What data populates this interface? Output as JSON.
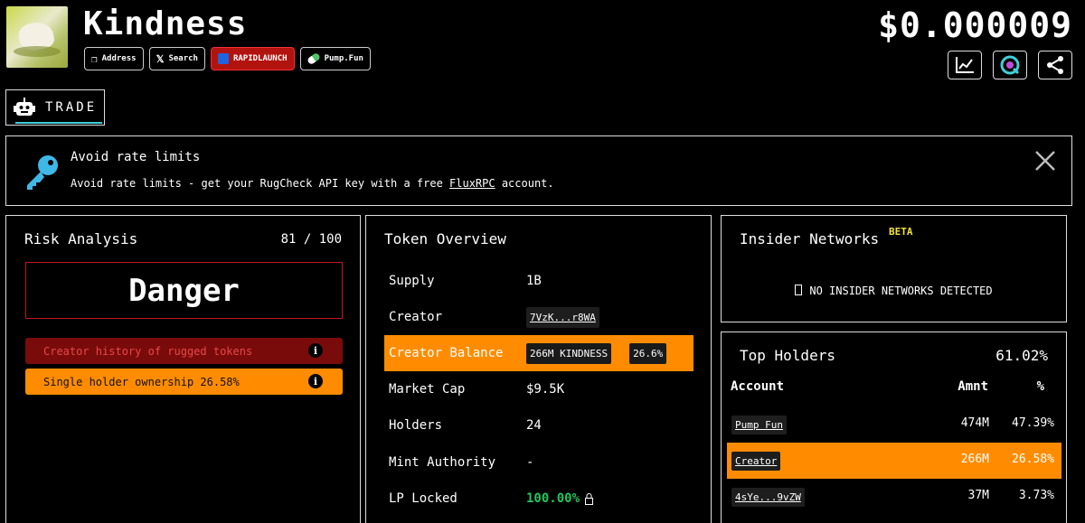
{
  "header": {
    "title": "Kindness",
    "price": "$0.000009",
    "links": [
      {
        "label": "Address",
        "icon": "copy-icon"
      },
      {
        "label": "Search",
        "icon": "x-logo-icon"
      },
      {
        "label": "RAPIDLAUNCH",
        "icon": "rapidlaunch-icon"
      },
      {
        "label": "Pump.Fun",
        "icon": "pill-icon"
      }
    ],
    "actions": [
      "chart-icon",
      "bubblemap-icon",
      "share-icon"
    ]
  },
  "tab": {
    "label": "TRADE"
  },
  "banner": {
    "title": "Avoid rate limits",
    "text_before": "Avoid rate limits - get your RugCheck API key with a free ",
    "link": "FluxRPC",
    "text_after": " account."
  },
  "risk": {
    "title": "Risk Analysis",
    "score": "81 / 100",
    "level": "Danger",
    "items": [
      {
        "label": "Creator history of rugged tokens"
      },
      {
        "label": "Single holder ownership 26.58%"
      }
    ]
  },
  "overview": {
    "title": "Token Overview",
    "supply_label": "Supply",
    "supply": "1B",
    "creator_label": "Creator",
    "creator": "7VzK...r8WA",
    "balance_label": "Creator Balance",
    "balance_amount": "266M KINDNESS",
    "balance_pct": "26.6%",
    "mcap_label": "Market Cap",
    "mcap": "$9.5K",
    "holders_label": "Holders",
    "holders": "24",
    "mint_label": "Mint Authority",
    "mint": "-",
    "lp_label": "LP Locked",
    "lp": "100.00%"
  },
  "insider": {
    "title": "Insider Networks",
    "badge": "BETA",
    "message": "NO INSIDER NETWORKS DETECTED"
  },
  "holders": {
    "title": "Top Holders",
    "total_pct": "61.02%",
    "col_account": "Account",
    "col_amount": "Amnt",
    "col_pct": "%",
    "rows": [
      {
        "account": "Pump Fun",
        "amount": "474M",
        "pct": "47.39%"
      },
      {
        "account": "Creator",
        "amount": "266M",
        "pct": "26.58%"
      },
      {
        "account": "4sYe...9vZW",
        "amount": "37M",
        "pct": "3.73%"
      }
    ]
  },
  "colors": {
    "accent": "#ff8c00",
    "danger": "#c21818",
    "danger_bg": "#7a0b0b",
    "tab_underline": "#3fd0d8",
    "positive": "#22c55e",
    "beta": "#f4e43a"
  }
}
